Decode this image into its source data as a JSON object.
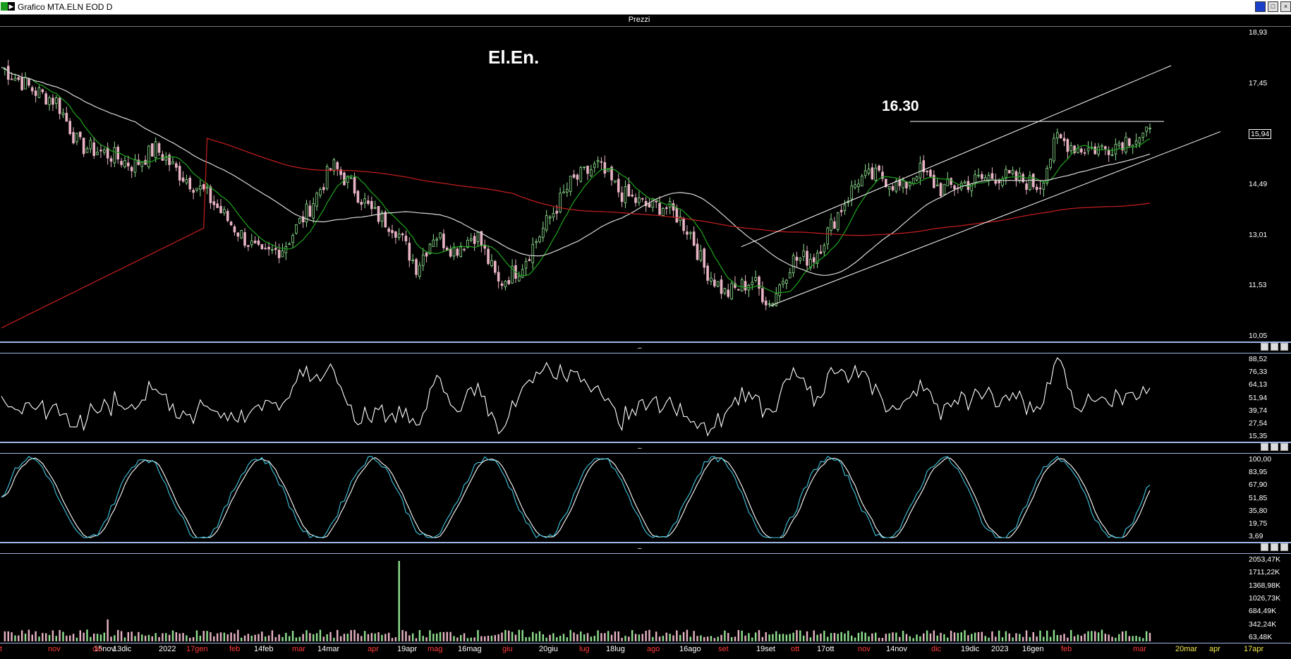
{
  "window": {
    "title": "Grafico MTA.ELN EOD D"
  },
  "price_panel": {
    "label": "Prezzi",
    "annotation_title": "El.En.",
    "annotation_level": "16.30",
    "yticks": [
      "18,93",
      "17,45",
      "15,94",
      "14,49",
      "13,01",
      "11,53",
      "10,05"
    ],
    "last_value": "15,94"
  },
  "rsi_panel": {
    "yticks": [
      "88,52",
      "76,33",
      "64,13",
      "51,94",
      "39,74",
      "27,54",
      "15,35"
    ]
  },
  "stoch_panel": {
    "yticks": [
      "100,00",
      "83,95",
      "67,90",
      "51,85",
      "35,80",
      "19,75",
      "3,69"
    ]
  },
  "volume_panel": {
    "yticks": [
      "2053,47K",
      "1711,22K",
      "1368,98K",
      "1026,73K",
      "684,49K",
      "342,24K",
      "63,48K"
    ]
  },
  "xaxis": {
    "labels": [
      {
        "t": "t",
        "c": "red"
      },
      {
        "t": "nov",
        "c": "red"
      },
      {
        "t": "15nov",
        "c": "white"
      },
      {
        "t": "dic",
        "c": "red"
      },
      {
        "t": "13dic",
        "c": "white"
      },
      {
        "t": "2022",
        "c": "white"
      },
      {
        "t": "17gen",
        "c": "red"
      },
      {
        "t": "feb",
        "c": "red"
      },
      {
        "t": "14feb",
        "c": "white"
      },
      {
        "t": "mar",
        "c": "red"
      },
      {
        "t": "14mar",
        "c": "white"
      },
      {
        "t": "apr",
        "c": "red"
      },
      {
        "t": "19apr",
        "c": "white"
      },
      {
        "t": "mag",
        "c": "red"
      },
      {
        "t": "16mag",
        "c": "white"
      },
      {
        "t": "giu",
        "c": "red"
      },
      {
        "t": "20giu",
        "c": "white"
      },
      {
        "t": "lug",
        "c": "red"
      },
      {
        "t": "18lug",
        "c": "white"
      },
      {
        "t": "ago",
        "c": "red"
      },
      {
        "t": "16ago",
        "c": "white"
      },
      {
        "t": "set",
        "c": "red"
      },
      {
        "t": "19set",
        "c": "white"
      },
      {
        "t": "ott",
        "c": "red"
      },
      {
        "t": "17ott",
        "c": "white"
      },
      {
        "t": "nov",
        "c": "red"
      },
      {
        "t": "14nov",
        "c": "white"
      },
      {
        "t": "dic",
        "c": "red"
      },
      {
        "t": "19dic",
        "c": "white"
      },
      {
        "t": "2023",
        "c": "white"
      },
      {
        "t": "16gen",
        "c": "white"
      },
      {
        "t": "feb",
        "c": "red"
      },
      {
        "t": "mar",
        "c": "red"
      },
      {
        "t": "20mar",
        "c": "yellow"
      },
      {
        "t": "apr",
        "c": "yellow"
      },
      {
        "t": "17apr",
        "c": "yellow"
      }
    ]
  },
  "colors": {
    "bull": "#8fe08f",
    "bear": "#e8b4c4",
    "sma_fast": "#1ea51e",
    "sma_mid": "#d9d9d9",
    "sma_slow": "#c81e1e",
    "stoch_k": "#3fc6e0",
    "grid": "#9fb7e4"
  }
}
